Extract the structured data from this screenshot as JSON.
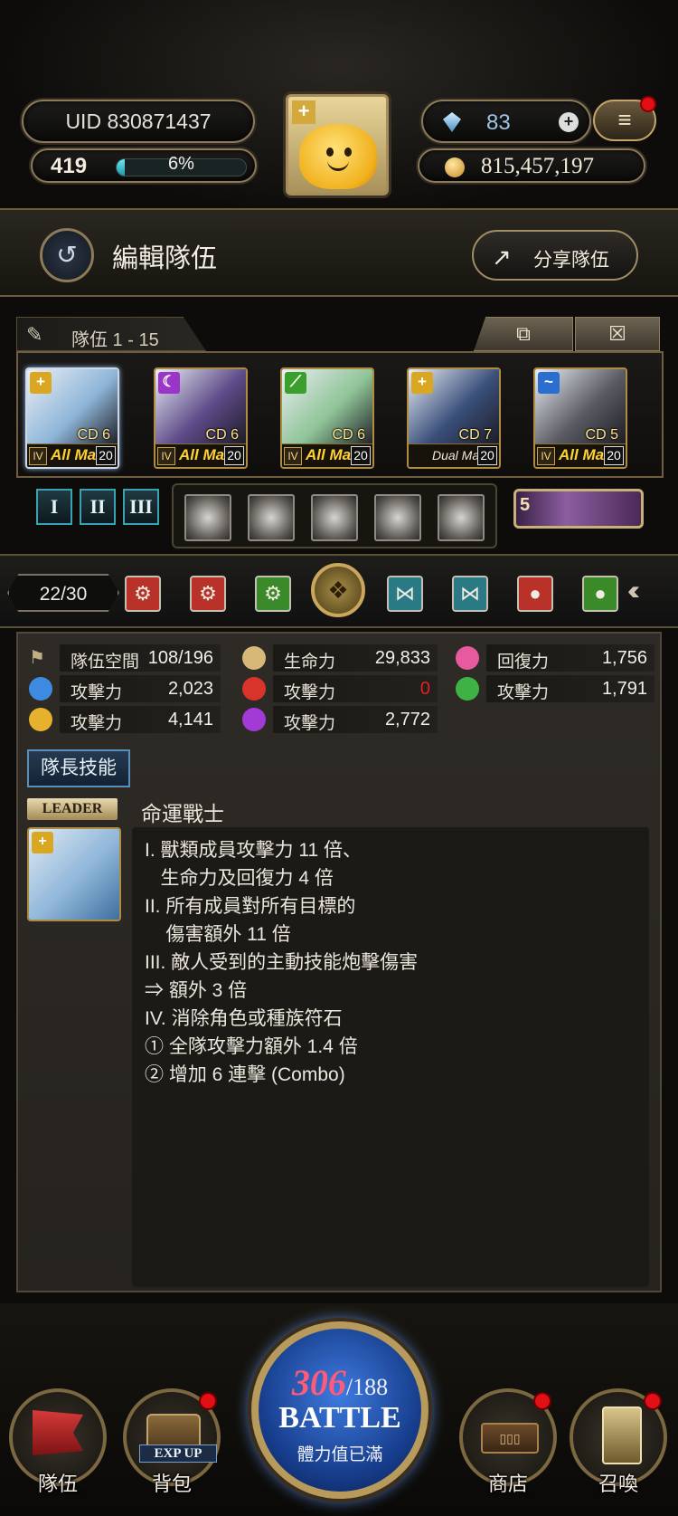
{
  "hud": {
    "uid": "UID 830871437",
    "level": "419",
    "exp_percent": 6,
    "exp_text": "6%",
    "gems": "83",
    "coins": "815,457,197"
  },
  "header": {
    "title": "編輯隊伍",
    "share_label": "分享隊伍"
  },
  "team": {
    "tab_label": "隊伍 1 - 15",
    "cards": [
      {
        "cd": "CD 6",
        "rank": "IV",
        "max": "All Max",
        "level": "20",
        "attr_color": "#d9a820",
        "art_color": "#8fb6d8"
      },
      {
        "cd": "CD 6",
        "rank": "IV",
        "max": "All Max",
        "level": "20",
        "attr_color": "#9b35c8",
        "art_color": "#5d4a88"
      },
      {
        "cd": "CD 6",
        "rank": "IV",
        "max": "All Max",
        "level": "20",
        "attr_color": "#3aa02c",
        "art_color": "#8fc496"
      },
      {
        "cd": "CD 7",
        "rank": "",
        "max": "Dual Max",
        "level": "20",
        "attr_color": "#d9a820",
        "art_color": "#3a4f7a"
      },
      {
        "cd": "CD 5",
        "rank": "IV",
        "max": "All Max",
        "level": "20",
        "attr_color": "#2a6fd0",
        "art_color": "#5a5a62"
      }
    ],
    "formations": [
      "I",
      "II",
      "III"
    ],
    "boss_number": "5"
  },
  "filter": {
    "count": "22/30",
    "icons": [
      {
        "name": "fire-rune-icon",
        "color": "#b8322a"
      },
      {
        "name": "fire-rune-icon",
        "color": "#b8322a"
      },
      {
        "name": "earth-rune-icon",
        "color": "#3a8a2a"
      },
      {
        "name": "beast-race-icon",
        "color": "#b8962a"
      },
      {
        "name": "butterfly-icon",
        "color": "#2a7a86"
      },
      {
        "name": "butterfly-icon",
        "color": "#2a7a86"
      },
      {
        "name": "head-fire-icon",
        "color": "#b8322a"
      },
      {
        "name": "head-earth-icon",
        "color": "#3a8a2a"
      }
    ]
  },
  "stats": {
    "team_space_label": "隊伍空間",
    "team_space_value": "108/196",
    "hp_label": "生命力",
    "hp_value": "29,833",
    "recovery_label": "回復力",
    "recovery_value": "1,756",
    "water_atk_label": "攻擊力",
    "water_atk_value": "2,023",
    "fire_atk_label": "攻擊力",
    "fire_atk_value": "0",
    "earth_atk_label": "攻擊力",
    "earth_atk_value": "1,791",
    "light_atk_label": "攻擊力",
    "light_atk_value": "4,141",
    "dark_atk_label": "攻擊力",
    "dark_atk_value": "2,772"
  },
  "leader": {
    "skill_tab": "隊長技能",
    "label": "LEADER",
    "name": "命運戰士",
    "lines": [
      "I. 獸類成員攻擊力 11 倍、",
      "   生命力及回復力 4 倍",
      "II. 所有成員對所有目標的",
      "    傷害額外 11 倍",
      "III. 敵人受到的主動技能炮擊傷害",
      "⇒ 額外 3 倍",
      "IV. 消除角色或種族符石",
      "① 全隊攻擊力額外 1.4 倍",
      "② 增加 6 連擊 (Combo)"
    ]
  },
  "nav": {
    "team": "隊伍",
    "bag": "背包",
    "exp_up": "EXP UP",
    "stamina_current": "306",
    "stamina_max": "/188",
    "battle": "BATTLE",
    "battle_sub": "體力值已滿",
    "shop": "商店",
    "summon": "召喚"
  },
  "colors": {
    "accent_gold": "#b08b42",
    "battle_blue": "#163c8a",
    "alert_red": "#e10f16",
    "zero_red": "#e62020"
  }
}
